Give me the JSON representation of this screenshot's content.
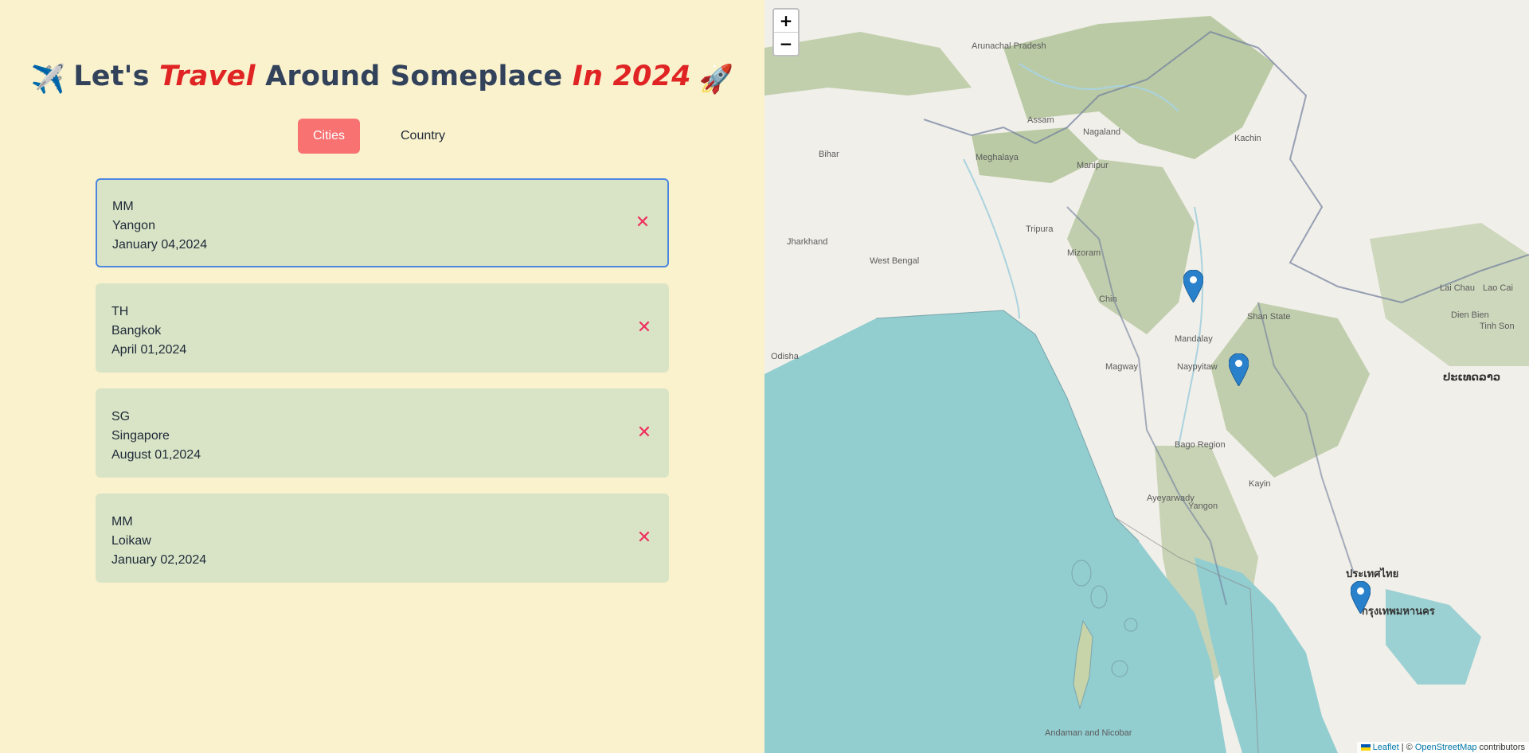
{
  "title": {
    "plane_emoji": "✈️",
    "part1": "Let's ",
    "accent1": "Travel",
    "part2": " Around Someplace ",
    "accent2": "In 2024",
    "rocket_emoji": "🚀"
  },
  "tabs": [
    {
      "label": "Cities",
      "active": true
    },
    {
      "label": "Country",
      "active": false
    }
  ],
  "trips": [
    {
      "country": "MM",
      "city": "Yangon",
      "date": "January 04,2024",
      "selected": true
    },
    {
      "country": "TH",
      "city": "Bangkok",
      "date": "April 01,2024",
      "selected": false
    },
    {
      "country": "SG",
      "city": "Singapore",
      "date": "August 01,2024",
      "selected": false
    },
    {
      "country": "MM",
      "city": "Loikaw",
      "date": "January 02,2024",
      "selected": false
    }
  ],
  "remove_symbol": "✕",
  "map": {
    "zoom_in": "+",
    "zoom_out": "−",
    "attribution": {
      "leaflet": "Leaflet",
      "separator": " | © ",
      "osm": "OpenStreetMap",
      "suffix": " contributors"
    },
    "labels": [
      "Arunachal Pradesh",
      "Assam",
      "Nagaland",
      "Bihar",
      "Meghalaya",
      "Manipur",
      "Jharkhand",
      "West Bengal",
      "Tripura",
      "Mizoram",
      "Chin",
      "Kachin",
      "Shan State",
      "Mandalay",
      "Magway",
      "Naypyitaw",
      "Bago Region",
      "Ayeyarwady",
      "Yangon",
      "Kayin",
      "Odisha",
      "Andaman and Nicobar",
      "ประเทศไทย",
      "กรุงเทพมหานคร",
      "ປະເທດລາວ",
      "Lai Chau",
      "Lao Cai",
      "Dien Bien",
      "Tinh Son"
    ],
    "colors": {
      "land": "#f1efe9",
      "water": "#aad3df",
      "sea": "#92cdd0",
      "forest": "#adc093",
      "marker": "#2a81cb"
    }
  }
}
